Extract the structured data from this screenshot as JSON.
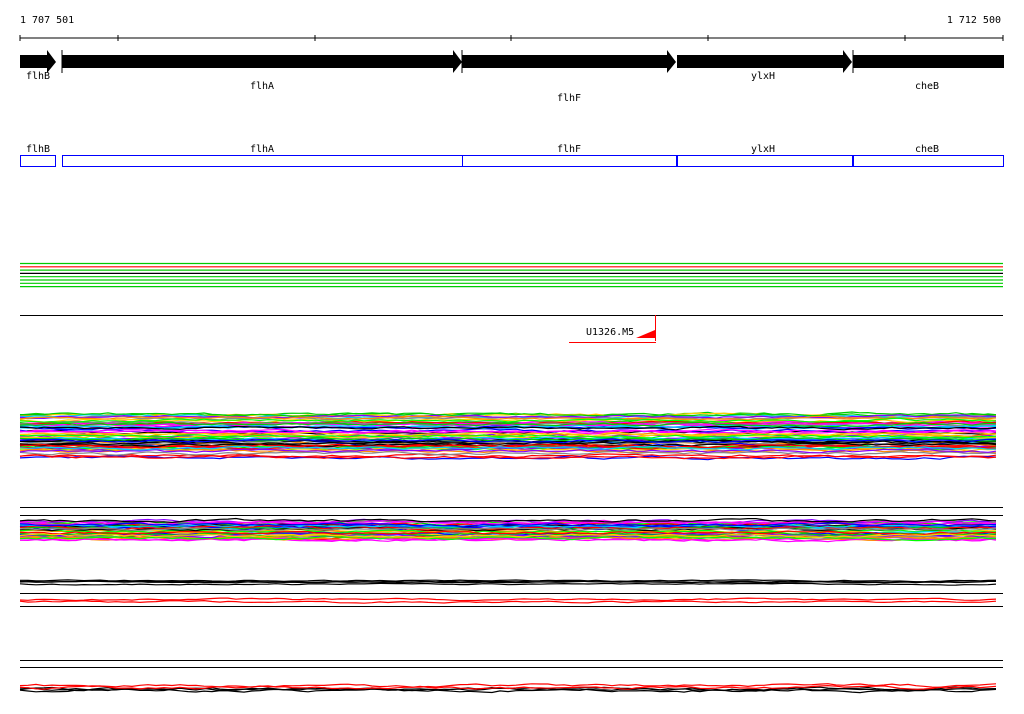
{
  "ruler": {
    "start_label": "1 707 501",
    "end_label": "1 712 500"
  },
  "genes": [
    {
      "name": "flhB",
      "strand": "+"
    },
    {
      "name": "flhA",
      "strand": "+"
    },
    {
      "name": "flhF",
      "strand": "+"
    },
    {
      "name": "ylxH",
      "strand": "+"
    },
    {
      "name": "cheB",
      "strand": "+"
    }
  ],
  "cds_track": {
    "labels": [
      "flhB",
      "flhA",
      "flhF",
      "ylxH",
      "cheB"
    ],
    "color": "#0000ff"
  },
  "feature": {
    "label": "U1326.M5",
    "color": "#ff0000"
  },
  "colors": {
    "palette": [
      "#00cc00",
      "#ff00ff",
      "#000000",
      "#ff0000",
      "#00ccff",
      "#ffcc00",
      "#0000ff",
      "#ff8800",
      "#00ff00",
      "#888888",
      "#8800ff"
    ],
    "flat_lines": [
      "#00cc00",
      "#ff0000",
      "#00cc00",
      "#000000",
      "#00cc00",
      "#00cc00",
      "#00cc00",
      "#00cc00"
    ]
  }
}
